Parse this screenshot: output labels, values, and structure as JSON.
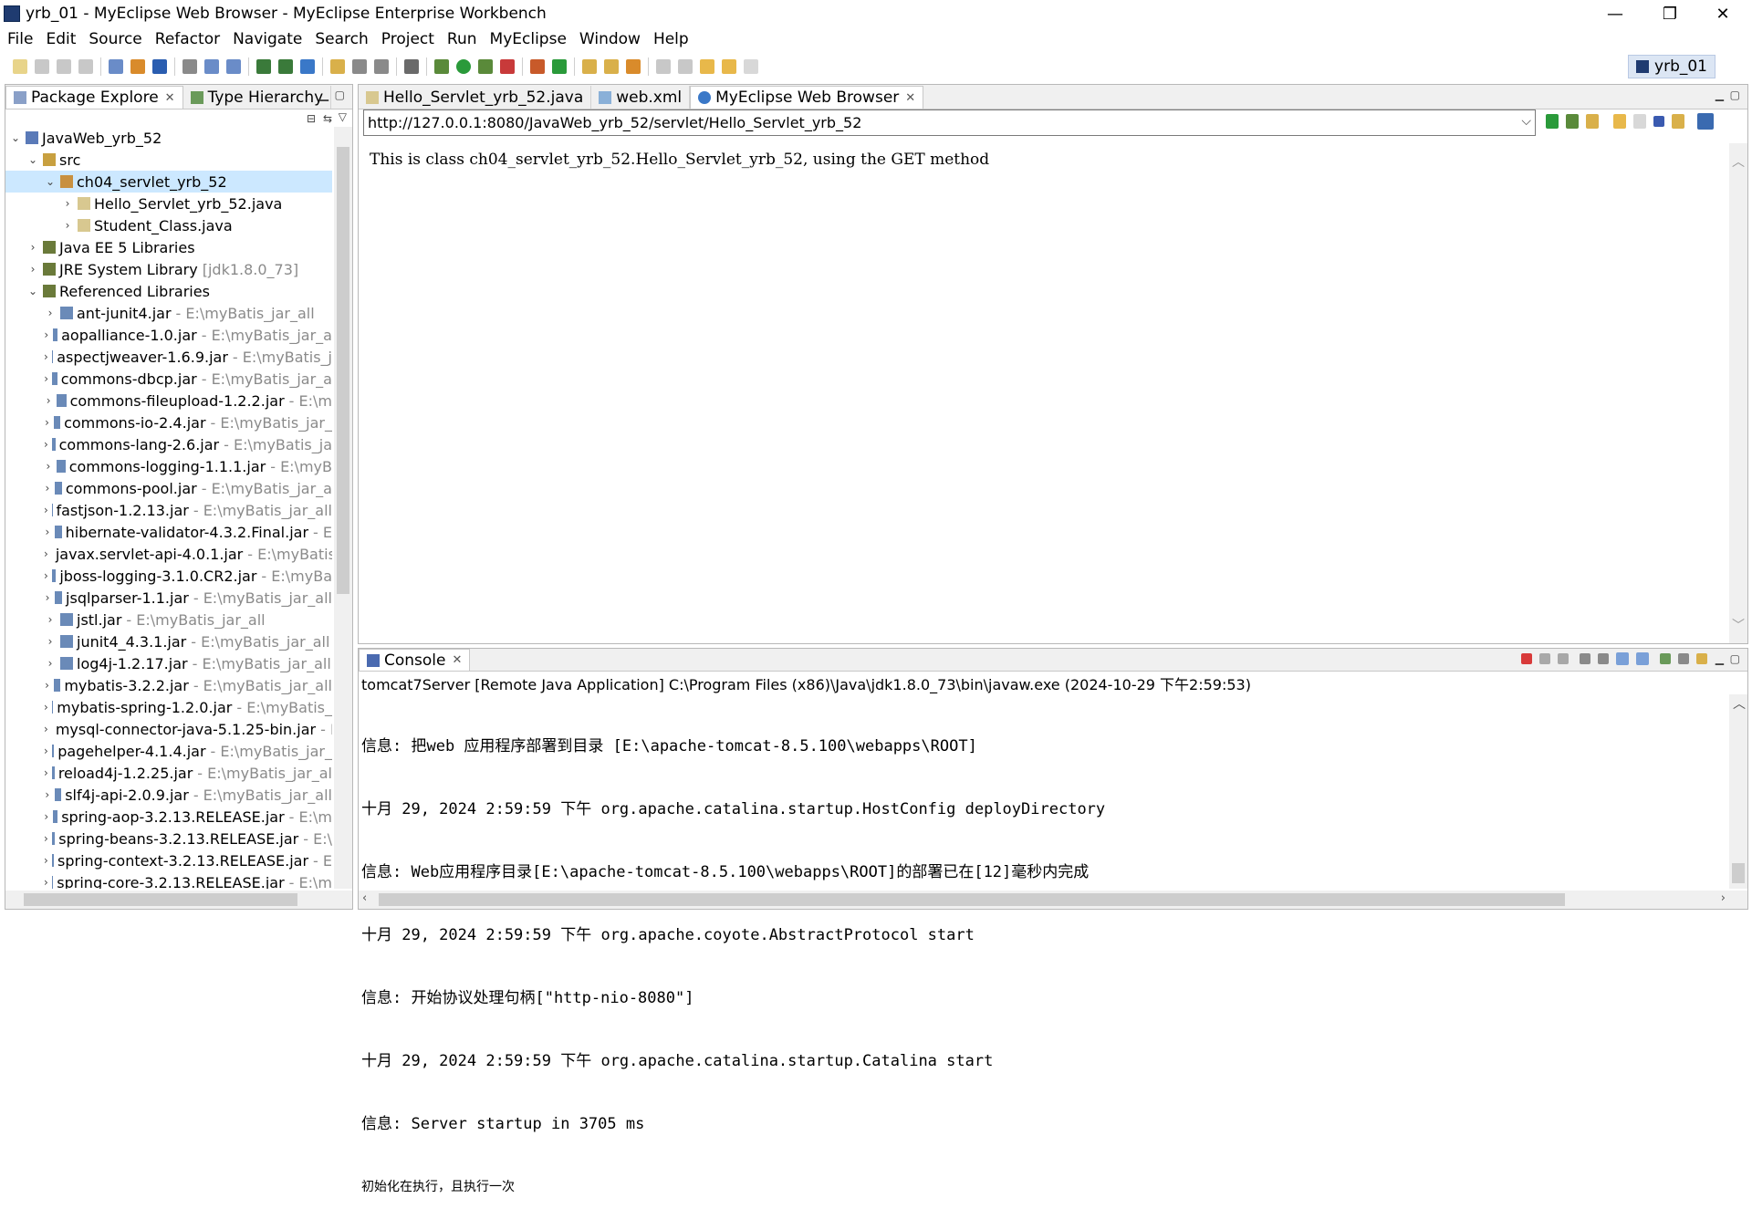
{
  "window": {
    "title": "yrb_01 - MyEclipse Web Browser - MyEclipse Enterprise Workbench",
    "minimize": "—",
    "maximize": "❐",
    "close": "✕"
  },
  "menu": [
    "File",
    "Edit",
    "Source",
    "Refactor",
    "Navigate",
    "Search",
    "Project",
    "Run",
    "MyEclipse",
    "Window",
    "Help"
  ],
  "perspective": {
    "label": "yrb_01"
  },
  "left_panel": {
    "tabs": [
      {
        "label": "Package Explore",
        "close": "✕"
      },
      {
        "label": "Type Hierarchy"
      }
    ],
    "tree": [
      {
        "label": "JavaWeb_yrb_52",
        "expanded": "v",
        "icon": "project-icon"
      },
      {
        "label": "src",
        "expanded": "v",
        "icon": "source-folder-icon"
      },
      {
        "label": "ch04_servlet_yrb_52",
        "expanded": "v",
        "icon": "package-icon"
      },
      {
        "label": "Hello_Servlet_yrb_52.java",
        "expanded": ">",
        "icon": "java-file-icon"
      },
      {
        "label": "Student_Class.java",
        "expanded": ">",
        "icon": "java-file-icon"
      },
      {
        "label": "Java EE 5 Libraries",
        "expanded": ">",
        "icon": "library-icon"
      },
      {
        "label": "JRE System Library",
        "suffix": "[jdk1.8.0_73]",
        "expanded": ">",
        "icon": "library-icon"
      },
      {
        "label": "Referenced Libraries",
        "expanded": "v",
        "icon": "library-icon"
      },
      {
        "label": "ant-junit4.jar",
        "suffix": "- E:\\myBatis_jar_all",
        "expanded": ">",
        "icon": "jar-icon"
      },
      {
        "label": "aopalliance-1.0.jar",
        "suffix": "- E:\\myBatis_jar_a",
        "expanded": ">",
        "icon": "jar-icon"
      },
      {
        "label": "aspectjweaver-1.6.9.jar",
        "suffix": "- E:\\myBatis_j",
        "expanded": ">",
        "icon": "jar-icon"
      },
      {
        "label": "commons-dbcp.jar",
        "suffix": "- E:\\myBatis_jar_a",
        "expanded": ">",
        "icon": "jar-icon"
      },
      {
        "label": "commons-fileupload-1.2.2.jar",
        "suffix": "- E:\\m",
        "expanded": ">",
        "icon": "jar-icon"
      },
      {
        "label": "commons-io-2.4.jar",
        "suffix": "- E:\\myBatis_jar_",
        "expanded": ">",
        "icon": "jar-icon"
      },
      {
        "label": "commons-lang-2.6.jar",
        "suffix": "- E:\\myBatis_ja",
        "expanded": ">",
        "icon": "jar-icon"
      },
      {
        "label": "commons-logging-1.1.1.jar",
        "suffix": "- E:\\myB",
        "expanded": ">",
        "icon": "jar-icon"
      },
      {
        "label": "commons-pool.jar",
        "suffix": "- E:\\myBatis_jar_a",
        "expanded": ">",
        "icon": "jar-icon"
      },
      {
        "label": "fastjson-1.2.13.jar",
        "suffix": "- E:\\myBatis_jar_all",
        "expanded": ">",
        "icon": "jar-icon"
      },
      {
        "label": "hibernate-validator-4.3.2.Final.jar",
        "suffix": "- E",
        "expanded": ">",
        "icon": "jar-icon"
      },
      {
        "label": "javax.servlet-api-4.0.1.jar",
        "suffix": "- E:\\myBatis",
        "expanded": ">",
        "icon": "jar-icon"
      },
      {
        "label": "jboss-logging-3.1.0.CR2.jar",
        "suffix": "- E:\\myBa",
        "expanded": ">",
        "icon": "jar-icon"
      },
      {
        "label": "jsqlparser-1.1.jar",
        "suffix": "- E:\\myBatis_jar_all",
        "expanded": ">",
        "icon": "jar-icon"
      },
      {
        "label": "jstl.jar",
        "suffix": "- E:\\myBatis_jar_all",
        "expanded": ">",
        "icon": "jar-icon"
      },
      {
        "label": "junit4_4.3.1.jar",
        "suffix": "- E:\\myBatis_jar_all",
        "expanded": ">",
        "icon": "jar-icon"
      },
      {
        "label": "log4j-1.2.17.jar",
        "suffix": "- E:\\myBatis_jar_all",
        "expanded": ">",
        "icon": "jar-icon"
      },
      {
        "label": "mybatis-3.2.2.jar",
        "suffix": "- E:\\myBatis_jar_all",
        "expanded": ">",
        "icon": "jar-icon"
      },
      {
        "label": "mybatis-spring-1.2.0.jar",
        "suffix": "- E:\\myBatis_",
        "expanded": ">",
        "icon": "jar-icon"
      },
      {
        "label": "mysql-connector-java-5.1.25-bin.jar",
        "suffix": "- E:\\",
        "expanded": ">",
        "icon": "jar-icon"
      },
      {
        "label": "pagehelper-4.1.4.jar",
        "suffix": "- E:\\myBatis_jar_",
        "expanded": ">",
        "icon": "jar-icon"
      },
      {
        "label": "reload4j-1.2.25.jar",
        "suffix": "- E:\\myBatis_jar_al",
        "expanded": ">",
        "icon": "jar-icon"
      },
      {
        "label": "slf4j-api-2.0.9.jar",
        "suffix": "- E:\\myBatis_jar_all",
        "expanded": ">",
        "icon": "jar-icon"
      },
      {
        "label": "spring-aop-3.2.13.RELEASE.jar",
        "suffix": "- E:\\m",
        "expanded": ">",
        "icon": "jar-icon"
      },
      {
        "label": "spring-beans-3.2.13.RELEASE.jar",
        "suffix": "- E:\\",
        "expanded": ">",
        "icon": "jar-icon"
      },
      {
        "label": "spring-context-3.2.13.RELEASE.jar",
        "suffix": "- E",
        "expanded": ">",
        "icon": "jar-icon"
      },
      {
        "label": "spring-core-3.2.13.RELEASE.jar",
        "suffix": "- E:\\m",
        "expanded": ">",
        "icon": "jar-icon"
      }
    ]
  },
  "editor": {
    "tabs": [
      {
        "label": "Hello_Servlet_yrb_52.java"
      },
      {
        "label": "web.xml"
      },
      {
        "label": "MyEclipse Web Browser",
        "close": "✕"
      }
    ],
    "url": "http://127.0.0.1:8080/JavaWeb_yrb_52/servlet/Hello_Servlet_yrb_52",
    "page_text": "This is class ch04_servlet_yrb_52.Hello_Servlet_yrb_52, using the GET method"
  },
  "console": {
    "tab_label": "Console",
    "tab_close": "✕",
    "process": "tomcat7Server [Remote Java Application] C:\\Program Files (x86)\\Java\\jdk1.8.0_73\\bin\\javaw.exe (2024-10-29 下午2:59:53)",
    "lines": [
      "信息: 把web 应用程序部署到目录 [E:\\apache-tomcat-8.5.100\\webapps\\ROOT]",
      "十月 29, 2024 2:59:59 下午 org.apache.catalina.startup.HostConfig deployDirectory",
      "信息: Web应用程序目录[E:\\apache-tomcat-8.5.100\\webapps\\ROOT]的部署已在[12]毫秒内完成",
      "十月 29, 2024 2:59:59 下午 org.apache.coyote.AbstractProtocol start",
      "信息: 开始协议处理句柄[\"http-nio-8080\"]",
      "十月 29, 2024 2:59:59 下午 org.apache.catalina.startup.Catalina start",
      "信息: Server startup in 3705 ms",
      "初始化在执行，且执行一次"
    ]
  }
}
